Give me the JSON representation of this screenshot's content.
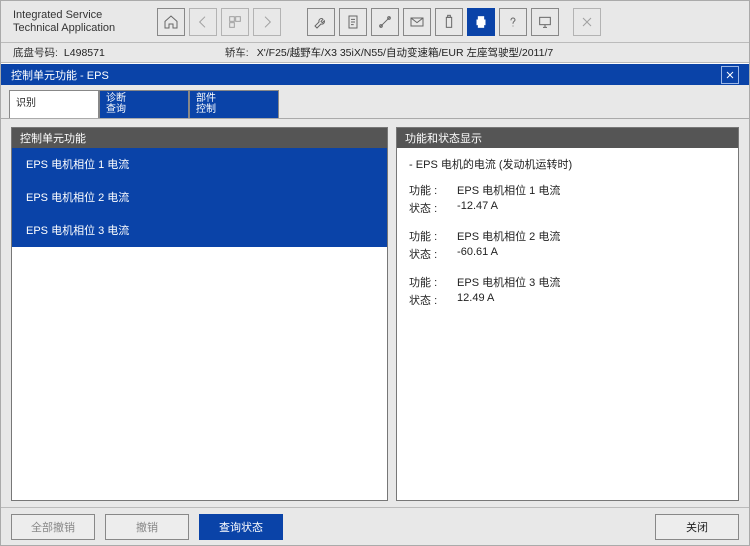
{
  "header": {
    "title1": "Integrated Service",
    "title2": "Technical Application"
  },
  "info": {
    "chassis_label": "底盘号码:",
    "chassis_value": "L498571",
    "vehicle_label": "轿车:",
    "vehicle_value": "X'/F25/越野车/X3 35iX/N55/自动变速箱/EUR 左座驾驶型/2011/7"
  },
  "module": {
    "title": "控制单元功能 - EPS"
  },
  "tabs": [
    {
      "l1": "识别",
      "l2": ""
    },
    {
      "l1": "诊断",
      "l2": "查询"
    },
    {
      "l1": "部件",
      "l2": "控制"
    }
  ],
  "left": {
    "header": "控制单元功能",
    "items": [
      "EPS 电机相位 1 电流",
      "EPS 电机相位 2 电流",
      "EPS 电机相位 3 电流"
    ]
  },
  "right": {
    "header": "功能和状态显示",
    "title": "- EPS 电机的电流 (发动机运转时)",
    "label_func": "功能 :",
    "label_state": "状态 :",
    "rows": [
      {
        "func": "EPS 电机相位 1 电流",
        "state": "-12.47 A"
      },
      {
        "func": "EPS 电机相位 2 电流",
        "state": "-60.61 A"
      },
      {
        "func": "EPS 电机相位 3 电流",
        "state": "12.49 A"
      }
    ]
  },
  "footer": {
    "back_all": "全部撤销",
    "back": "撤销",
    "query": "查询状态",
    "close": "关闭"
  }
}
